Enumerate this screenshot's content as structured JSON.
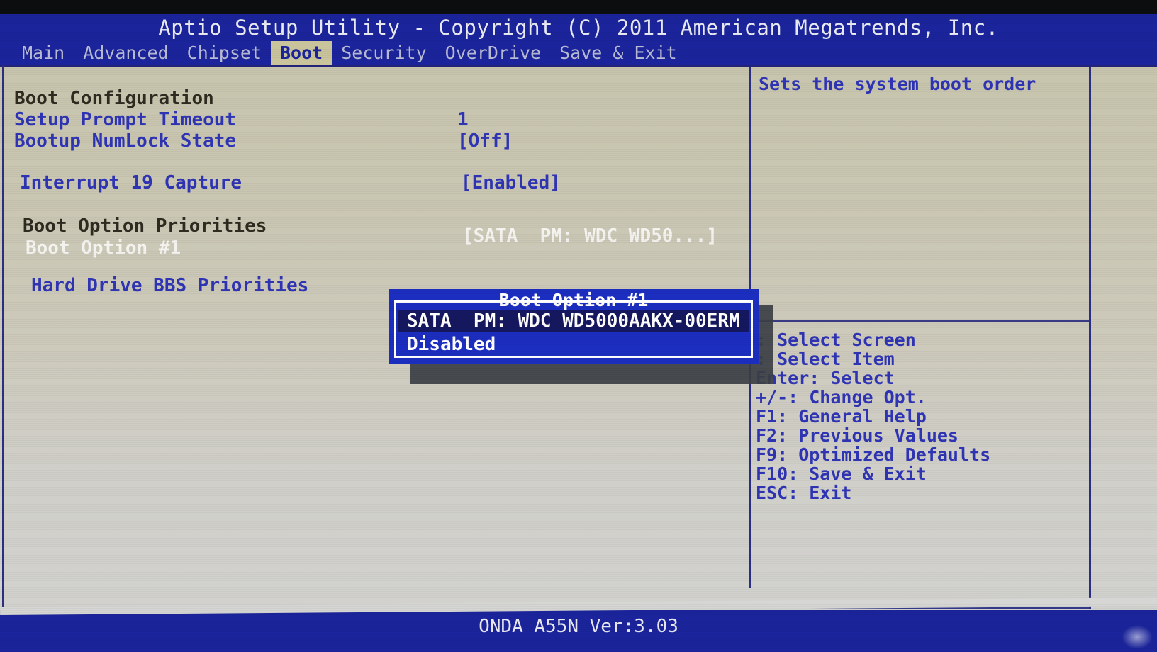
{
  "header": {
    "title": "Aptio Setup Utility - Copyright (C) 2011 American Megatrends, Inc."
  },
  "menu": {
    "tabs": [
      {
        "label": "Main",
        "active": false
      },
      {
        "label": "Advanced",
        "active": false
      },
      {
        "label": "Chipset",
        "active": false
      },
      {
        "label": "Boot",
        "active": true
      },
      {
        "label": "Security",
        "active": false
      },
      {
        "label": "OverDrive",
        "active": false
      },
      {
        "label": "Save & Exit",
        "active": false
      }
    ]
  },
  "settings": {
    "section_title": "Boot Configuration",
    "rows": [
      {
        "label": "Setup Prompt Timeout",
        "value": "1",
        "style": "item",
        "value_style": "normal"
      },
      {
        "label": "Bootup NumLock State",
        "value": "[Off]",
        "style": "item",
        "value_style": "normal"
      },
      {
        "label": "Interrupt 19 Capture",
        "value": "[Enabled]",
        "style": "item",
        "value_style": "normal"
      }
    ],
    "priorities_title": "Boot Option Priorities",
    "priority_row": {
      "label": "Boot Option #1",
      "value": "[SATA  PM: WDC WD50...]"
    },
    "bbs_link": "Hard Drive BBS Priorities"
  },
  "popup": {
    "title": "Boot Option #1",
    "options": [
      {
        "label": "SATA  PM: WDC WD5000AAKX-00ERM",
        "selected": true
      },
      {
        "label": "Disabled",
        "selected": false
      }
    ]
  },
  "help": {
    "description": "Sets the system boot order",
    "keys": [
      ": Select Screen",
      ": Select Item",
      "Enter: Select",
      "+/-: Change Opt.",
      "F1: General Help",
      "F2: Previous Values",
      "F9: Optimized Defaults",
      "F10: Save & Exit",
      "ESC: Exit"
    ]
  },
  "footer": {
    "version": "ONDA A55N Ver:3.03"
  },
  "colors": {
    "header_blue": "#1b249a",
    "body_beige": "#c9c6b2",
    "text_blue": "#2f34b4",
    "text_dark": "#2e2b20",
    "highlight_white": "#f4f3ef",
    "tab_active_bg": "#c9c49b",
    "popup_blue": "#1c2ec0",
    "popup_select": "#16185f"
  }
}
